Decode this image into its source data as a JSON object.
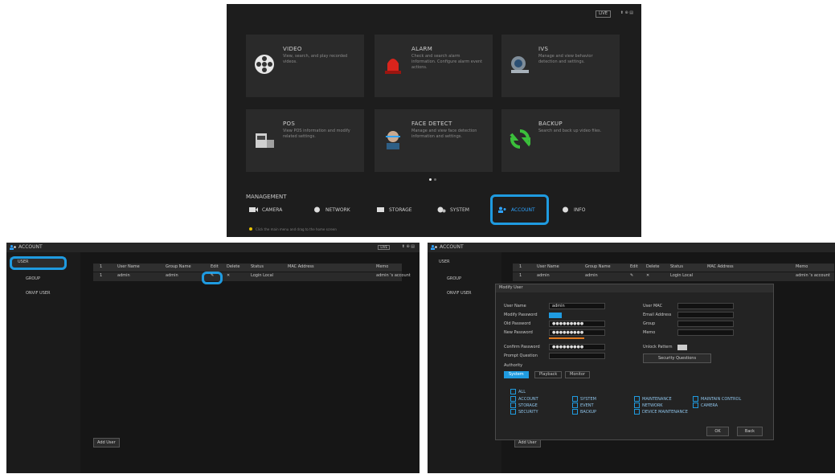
{
  "menu": {
    "tiles": [
      {
        "title": "VIDEO",
        "desc": "View, search, and play recorded videos.",
        "icon": "film-reel-icon"
      },
      {
        "title": "ALARM",
        "desc": "Check and search alarm information. Configure alarm event actions.",
        "icon": "siren-icon"
      },
      {
        "title": "IVS",
        "desc": "Manage and view behavior detection and settings.",
        "icon": "ivs-camera-icon"
      },
      {
        "title": "POS",
        "desc": "View POS information and modify related settings.",
        "icon": "pos-terminal-icon"
      },
      {
        "title": "FACE DETECT",
        "desc": "Manage and view face detection information and settings.",
        "icon": "face-scan-icon"
      },
      {
        "title": "BACKUP",
        "desc": "Search and back up video files.",
        "icon": "backup-arrows-icon"
      }
    ],
    "management_label": "MANAGEMENT",
    "management_items": [
      {
        "label": "CAMERA",
        "icon": "camera-icon"
      },
      {
        "label": "NETWORK",
        "icon": "network-icon"
      },
      {
        "label": "STORAGE",
        "icon": "storage-icon"
      },
      {
        "label": "SYSTEM",
        "icon": "system-gear-icon"
      },
      {
        "label": "ACCOUNT",
        "icon": "account-users-icon"
      },
      {
        "label": "INFO",
        "icon": "info-icon"
      }
    ],
    "footer_tip": "Click the main menu and drag to the home screen",
    "top_badge": "LIVE"
  },
  "account": {
    "title": "ACCOUNT",
    "sidebar": [
      "USER",
      "GROUP",
      "ONVIF USER"
    ],
    "columns": [
      "1",
      "User Name",
      "Group Name",
      "Edit",
      "Delete",
      "Status",
      "MAC Address",
      "Memo"
    ],
    "rows": [
      {
        "no": "1",
        "user": "admin",
        "group": "admin",
        "edit": "✎",
        "delete": "✕",
        "status": "Login Local",
        "mac": "",
        "memo": "admin 's account"
      }
    ],
    "add_user": "Add User",
    "top_badge": "LIVE"
  },
  "modify": {
    "dialog_title": "Modify User",
    "fields_left": [
      {
        "label": "User Name",
        "value": "admin"
      },
      {
        "label": "Modify Password",
        "value": ""
      },
      {
        "label": "Old Password",
        "value": "●●●●●●●●●"
      },
      {
        "label": "New Password",
        "value": "●●●●●●●●●"
      },
      {
        "label": "Confirm Password",
        "value": "●●●●●●●●●"
      },
      {
        "label": "Prompt Question",
        "value": ""
      }
    ],
    "fields_right": [
      {
        "label": "User MAC",
        "value": ""
      },
      {
        "label": "Email Address",
        "value": ""
      },
      {
        "label": "Group",
        "value": ""
      },
      {
        "label": "Memo",
        "value": ""
      }
    ],
    "unlock_pattern": "Unlock Pattern",
    "security_questions": "Security Questions",
    "authority": "Authority",
    "tabs": [
      "System",
      "Playback",
      "Monitor"
    ],
    "checks": [
      [
        "ALL"
      ],
      [
        "ACCOUNT",
        "SYSTEM",
        "MAINTENANCE",
        "MAINTAIN CONTROL"
      ],
      [
        "STORAGE",
        "EVENT",
        "NETWORK",
        "CAMERA"
      ],
      [
        "SECURITY",
        "BACKUP",
        "DEVICE MAINTENANCE"
      ]
    ],
    "ok": "OK",
    "cancel": "Back"
  }
}
